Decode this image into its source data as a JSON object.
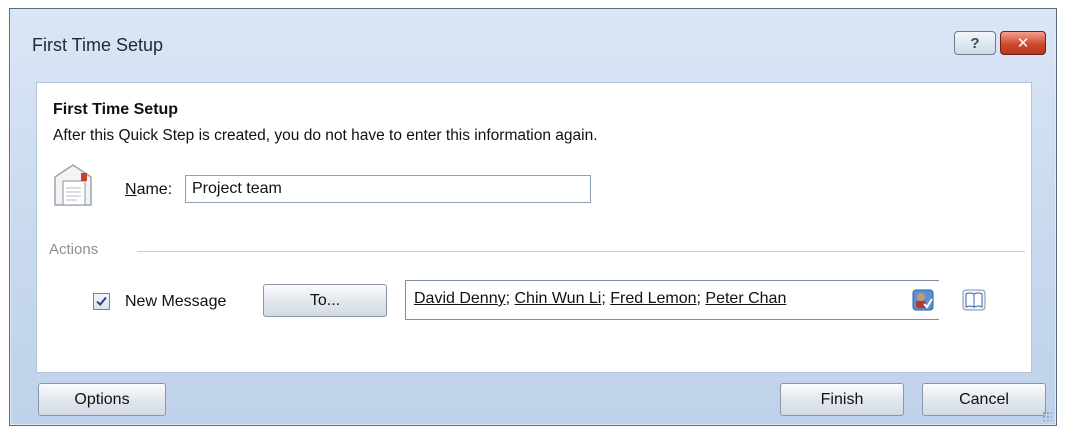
{
  "window": {
    "title": "First Time Setup",
    "help_label": "?",
    "close_label": "✕"
  },
  "panel": {
    "heading": "First Time Setup",
    "description": "After this Quick Step is created, you do not have to enter this information again.",
    "name_label_accel": "N",
    "name_label_rest": "ame:",
    "name_value": "Project team",
    "actions_label": "Actions",
    "new_message_label": "New Message",
    "new_message_checked": true,
    "to_button_label": "To...",
    "recipients": [
      "David Denny",
      "Chin Wun Li",
      "Fred Lemon",
      "Peter Chan"
    ]
  },
  "footer": {
    "options_label": "Options",
    "finish_label": "Finish",
    "cancel_label": "Cancel"
  },
  "icons": {
    "name_icon": "quick-step-mail-icon",
    "check_names": "check-names-icon",
    "address_book": "address-book-icon"
  }
}
